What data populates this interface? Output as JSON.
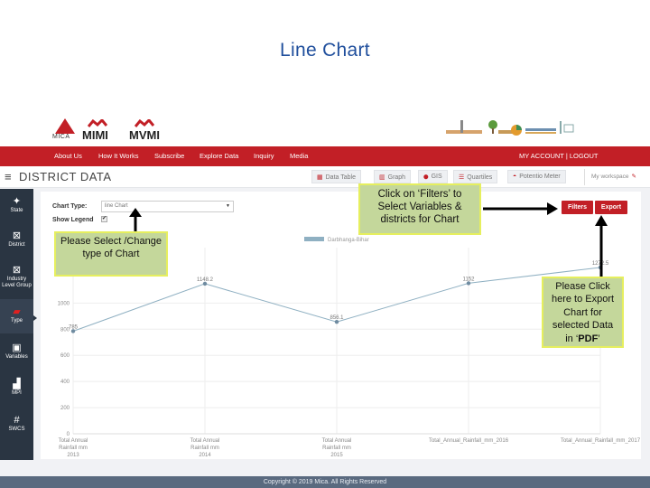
{
  "slide": {
    "title": "Line Chart"
  },
  "header": {
    "logos": [
      {
        "name": "MICA",
        "text": "MICA"
      },
      {
        "name": "MIMI",
        "text": "MIMI"
      },
      {
        "name": "MVMI",
        "text": "MVMI"
      }
    ],
    "nav": [
      {
        "label": "About Us"
      },
      {
        "label": "How It Works"
      },
      {
        "label": "Subscribe"
      },
      {
        "label": "Explore Data"
      },
      {
        "label": "Inquiry"
      },
      {
        "label": "Media"
      }
    ],
    "account": "MY ACCOUNT | LOGOUT"
  },
  "subheader": {
    "menu_icon": "hamburger-icon",
    "title": "DISTRICT DATA",
    "tools": [
      {
        "label": "Data Table",
        "icon": "table-icon",
        "glyph": "▦"
      },
      {
        "label": "Graph",
        "icon": "bar-chart-icon",
        "glyph": "▥"
      },
      {
        "label": "GIS",
        "icon": "map-marker-icon",
        "glyph": "⬤"
      },
      {
        "label": "Quartiles",
        "icon": "list-icon",
        "glyph": "☰"
      },
      {
        "label": "Potentio Meter",
        "icon": "dashboard-icon",
        "glyph": "◓"
      }
    ],
    "workspace": {
      "label": "My workspace",
      "icon": "pencil-icon",
      "glyph": "✎"
    }
  },
  "sidebar": {
    "items": [
      {
        "label": "State",
        "icon": "india-map-icon",
        "glyph": "✦"
      },
      {
        "label": "District",
        "icon": "district-grid-icon",
        "glyph": "⊠"
      },
      {
        "label": "Industry Level Group",
        "icon": "industry-grid-icon",
        "glyph": "⊠"
      },
      {
        "label": "Type",
        "icon": "type-icon",
        "glyph": "▰",
        "active": true
      },
      {
        "label": "Variables",
        "icon": "variables-icon",
        "glyph": "▣"
      },
      {
        "label": "MPI",
        "icon": "mpi-chart-icon",
        "glyph": "▟"
      },
      {
        "label": "SWCS",
        "icon": "hash-icon",
        "glyph": "#"
      }
    ]
  },
  "controls": {
    "chart_type_label": "Chart Type:",
    "chart_type_value": "line Chart",
    "show_legend_label": "Show Legend",
    "show_legend_checked": "✔",
    "filters_label": "Filters",
    "export_label": "Export"
  },
  "chart_data": {
    "type": "line",
    "title": "",
    "xlabel": "",
    "ylabel": "",
    "categories": [
      [
        "Total Annual",
        "Rainfall mm",
        "2013"
      ],
      [
        "Total Annual",
        "Rainfall mm",
        "2014"
      ],
      [
        "Total Annual",
        "Rainfall mm",
        "2015"
      ],
      [
        "Total_Annual_Rainfall_mm_2016"
      ],
      [
        "Total_Annual_Rainfall_mm_2017"
      ]
    ],
    "series": [
      {
        "name": "Darbhanga-Bihar",
        "color": "#8fb0c2",
        "values": [
          785,
          1148.2,
          856.1,
          1152,
          1272.5
        ],
        "labels": [
          "785",
          "1148.2",
          "856.1",
          "1152",
          "1272.5"
        ]
      }
    ],
    "yticks": [
      0,
      200,
      400,
      600,
      800,
      1000
    ],
    "ylim": [
      0,
      1300
    ],
    "grid": true,
    "legend": "top-center"
  },
  "callouts": {
    "select_chart": "Please Select /Change  type of Chart",
    "filters": [
      "Click on ‘Filters’ to",
      "Select Variables &",
      "districts for Chart"
    ],
    "export": [
      "Please Click",
      "here to Export",
      "Chart for",
      "selected Data",
      "in ‘"
    ],
    "export_bold": "PDF",
    "export_tail": "’"
  },
  "footer": {
    "copyright": "Copyright © 2019 Mica. All Rights Reserved"
  }
}
